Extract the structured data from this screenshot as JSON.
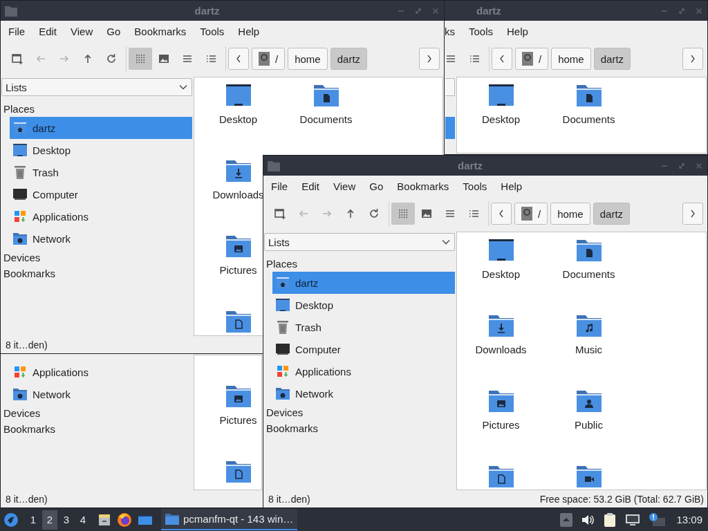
{
  "windows": [
    {
      "kind": "full",
      "title": "dartz",
      "menu": [
        "File",
        "Edit",
        "View",
        "Go",
        "Bookmarks",
        "Tools",
        "Help"
      ],
      "toolbar": [
        {
          "kind": "new-tab",
          "disabled": false
        },
        {
          "kind": "back",
          "disabled": true
        },
        {
          "kind": "forward",
          "disabled": true
        },
        {
          "kind": "up",
          "disabled": false
        },
        {
          "kind": "reload",
          "disabled": false
        }
      ],
      "view_modes": [
        {
          "kind": "icons",
          "selected": true
        },
        {
          "kind": "thumbnails",
          "selected": false
        },
        {
          "kind": "compact",
          "selected": false
        },
        {
          "kind": "details",
          "selected": false
        }
      ],
      "breadcrumb": [
        {
          "label": "/",
          "kind": "root",
          "selected": false
        },
        {
          "label": "home",
          "selected": false
        },
        {
          "label": "dartz",
          "selected": true
        }
      ],
      "sidebar": {
        "combo": "Lists",
        "heading": "Places",
        "places": [
          {
            "label": "dartz",
            "kind": "home",
            "selected": true
          },
          {
            "label": "Desktop",
            "kind": "desktop",
            "selected": false
          },
          {
            "label": "Trash",
            "kind": "trash",
            "selected": false
          },
          {
            "label": "Computer",
            "kind": "computer",
            "selected": false
          },
          {
            "label": "Applications",
            "kind": "applications",
            "selected": false
          },
          {
            "label": "Network",
            "kind": "network",
            "selected": false
          }
        ],
        "sections": [
          "Devices",
          "Bookmarks"
        ]
      },
      "files": [
        {
          "label": "Desktop",
          "kind": "desktop"
        },
        {
          "label": "Downloads",
          "kind": "downloads"
        },
        {
          "label": "Pictures",
          "kind": "pictures"
        },
        {
          "kind": "templates"
        },
        {
          "label": "Documents",
          "kind": "documents"
        }
      ],
      "status_left": "8 it…den)"
    },
    {
      "kind": "top-fragment",
      "title": "dartz",
      "menu": [
        "ks",
        "Tools",
        "Help"
      ],
      "view_modes": [
        {
          "kind": "compact",
          "selected": false
        },
        {
          "kind": "details",
          "selected": false
        }
      ],
      "breadcrumb": [
        {
          "label": "/",
          "kind": "root",
          "selected": false
        },
        {
          "label": "home",
          "selected": false
        },
        {
          "label": "dartz",
          "selected": true
        }
      ],
      "sidebar": {
        "places": [
          {
            "selected": true
          }
        ]
      },
      "files": [
        {
          "label": "Desktop",
          "kind": "desktop"
        },
        {
          "label": "Documents",
          "kind": "documents"
        }
      ]
    },
    {
      "kind": "bottom-fragment",
      "sidebar": {
        "places": [
          {
            "label": "Applications",
            "kind": "applications",
            "selected": false
          },
          {
            "label": "Network",
            "kind": "network",
            "selected": false
          }
        ],
        "sections": [
          "Devices",
          "Bookmarks"
        ]
      },
      "files": [
        {
          "label": "Pictures",
          "kind": "pictures"
        },
        {
          "kind": "templates"
        }
      ],
      "status_left": "8 it…den)"
    },
    {
      "kind": "full",
      "title": "dartz",
      "menu": [
        "File",
        "Edit",
        "View",
        "Go",
        "Bookmarks",
        "Tools",
        "Help"
      ],
      "toolbar": [
        {
          "kind": "new-tab",
          "disabled": false
        },
        {
          "kind": "back",
          "disabled": true
        },
        {
          "kind": "forward",
          "disabled": true
        },
        {
          "kind": "up",
          "disabled": false
        },
        {
          "kind": "reload",
          "disabled": false
        }
      ],
      "view_modes": [
        {
          "kind": "icons",
          "selected": true
        },
        {
          "kind": "thumbnails",
          "selected": false
        },
        {
          "kind": "compact",
          "selected": false
        },
        {
          "kind": "details",
          "selected": false
        }
      ],
      "breadcrumb": [
        {
          "label": "/",
          "kind": "root",
          "selected": false
        },
        {
          "label": "home",
          "selected": false
        },
        {
          "label": "dartz",
          "selected": true
        }
      ],
      "sidebar": {
        "combo": "Lists",
        "heading": "Places",
        "places": [
          {
            "label": "dartz",
            "kind": "home",
            "selected": true
          },
          {
            "label": "Desktop",
            "kind": "desktop",
            "selected": false
          },
          {
            "label": "Trash",
            "kind": "trash",
            "selected": false
          },
          {
            "label": "Computer",
            "kind": "computer",
            "selected": false
          },
          {
            "label": "Applications",
            "kind": "applications",
            "selected": false
          },
          {
            "label": "Network",
            "kind": "network",
            "selected": false
          }
        ],
        "sections": [
          "Devices",
          "Bookmarks"
        ]
      },
      "files": [
        {
          "label": "Desktop",
          "kind": "desktop"
        },
        {
          "label": "Downloads",
          "kind": "downloads"
        },
        {
          "label": "Pictures",
          "kind": "pictures"
        },
        {
          "kind": "templates"
        },
        {
          "label": "Documents",
          "kind": "documents"
        },
        {
          "label": "Music",
          "kind": "music"
        },
        {
          "label": "Public",
          "kind": "public"
        },
        {
          "kind": "videos"
        }
      ],
      "status_left": "8 it…den)",
      "status_right": "Free space: 53.2 GiB (Total: 62.7 GiB)"
    }
  ],
  "taskbar": {
    "workspaces": [
      {
        "label": "1",
        "selected": false
      },
      {
        "label": "2",
        "selected": true
      },
      {
        "label": "3",
        "selected": false
      },
      {
        "label": "4",
        "selected": false
      }
    ],
    "task": {
      "label": "pcmanfm-qt - 143 win…",
      "selected": true
    },
    "clock": "13:09"
  }
}
